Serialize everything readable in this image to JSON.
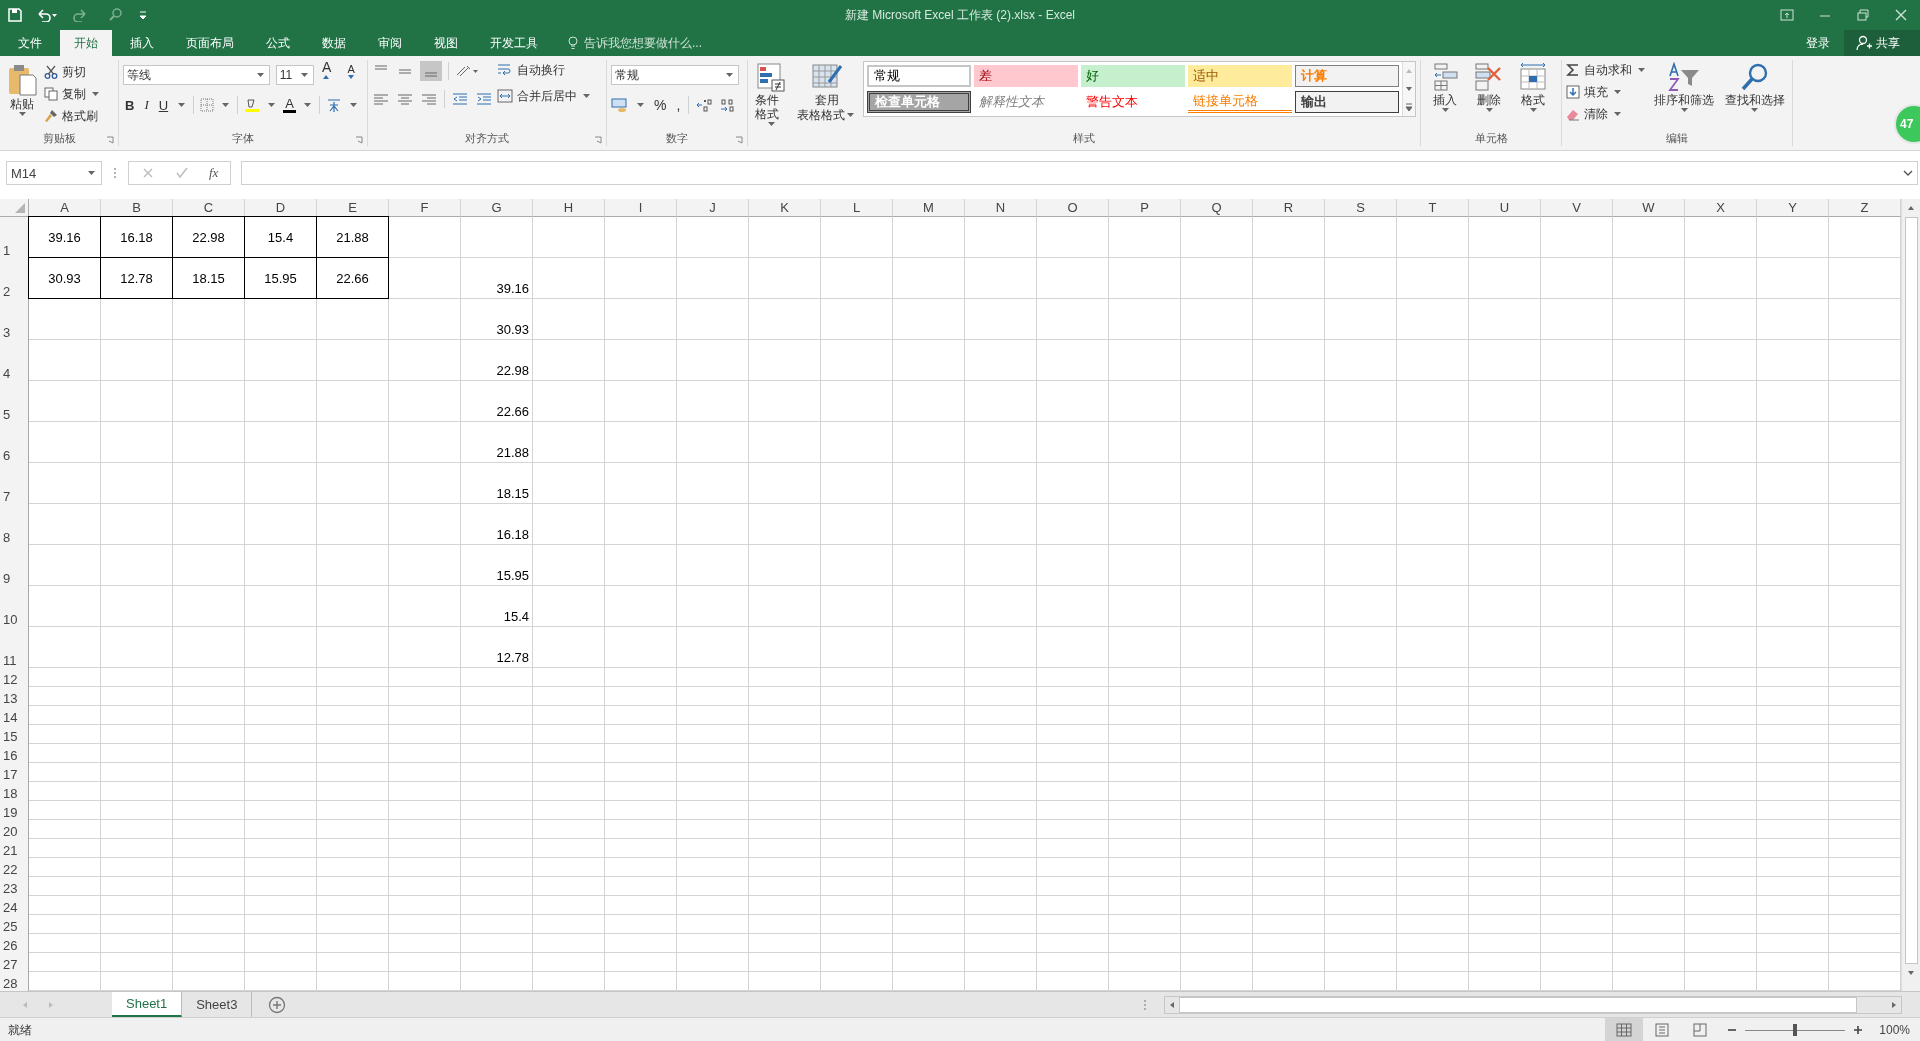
{
  "window": {
    "title": "新建 Microsoft Excel 工作表 (2).xlsx - Excel"
  },
  "tabs": [
    {
      "label": "文件",
      "selected": false
    },
    {
      "label": "开始",
      "selected": true
    },
    {
      "label": "插入",
      "selected": false
    },
    {
      "label": "页面布局",
      "selected": false
    },
    {
      "label": "公式",
      "selected": false
    },
    {
      "label": "数据",
      "selected": false
    },
    {
      "label": "审阅",
      "selected": false
    },
    {
      "label": "视图",
      "selected": false
    },
    {
      "label": "开发工具",
      "selected": false
    }
  ],
  "tell_me": {
    "placeholder": "告诉我您想要做什么..."
  },
  "account": {
    "sign_in": "登录",
    "share": "共享"
  },
  "ribbon": {
    "clipboard": {
      "paste": "粘贴",
      "cut": "剪切",
      "copy": "复制",
      "format_painter": "格式刷",
      "label": "剪贴板"
    },
    "font": {
      "font_name": "等线",
      "font_size": "11",
      "grow_font": "A",
      "shrink_font": "A",
      "bold": "B",
      "italic": "I",
      "underline": "U",
      "font_color": "A",
      "label": "字体"
    },
    "alignment": {
      "wrap_text": "自动换行",
      "merge_center": "合并后居中",
      "label": "对齐方式"
    },
    "number": {
      "format": "常规",
      "percent": "%",
      "comma": ",",
      "label": "数字"
    },
    "styles": {
      "conditional_formatting": "条件格式",
      "format_as_table": [
        "套用",
        "表格格式"
      ],
      "cell_styles": [
        {
          "label": "常规",
          "kind": "normal"
        },
        {
          "label": "差",
          "kind": "bad"
        },
        {
          "label": "好",
          "kind": "good"
        },
        {
          "label": "适中",
          "kind": "neutral"
        },
        {
          "label": "计算",
          "kind": "calculation"
        },
        {
          "label": "检查单元格",
          "kind": "check"
        },
        {
          "label": "解释性文本",
          "kind": "explanatory"
        },
        {
          "label": "警告文本",
          "kind": "warning"
        },
        {
          "label": "链接单元格",
          "kind": "linked"
        },
        {
          "label": "输出",
          "kind": "output"
        }
      ],
      "label": "样式"
    },
    "cells": {
      "insert": "插入",
      "delete": "删除",
      "format": "格式",
      "label": "单元格"
    },
    "editing": {
      "autosum": "自动求和",
      "fill": "填充",
      "clear": "清除",
      "sort_filter": "排序和筛选",
      "find_select": "查找和选择",
      "label": "编辑"
    }
  },
  "badge": {
    "text": "47"
  },
  "formula_bar": {
    "name_box": "M14",
    "function_label": "fx"
  },
  "sheet": {
    "columns": [
      "A",
      "B",
      "C",
      "D",
      "E",
      "F",
      "G",
      "H",
      "I",
      "J",
      "K",
      "L",
      "M",
      "N",
      "O",
      "P",
      "Q",
      "R",
      "S",
      "T",
      "U",
      "V",
      "W",
      "X",
      "Y",
      "Z"
    ],
    "rows": [
      {
        "label": "1",
        "cells": [
          {
            "value": "39.16",
            "bordered": true
          },
          {
            "value": "16.18",
            "bordered": true
          },
          {
            "value": "22.98",
            "bordered": true
          },
          {
            "value": "15.4",
            "bordered": true
          },
          {
            "value": "21.88",
            "bordered": true
          }
        ]
      },
      {
        "label": "2",
        "cells": [
          {
            "value": "30.93",
            "bordered": true
          },
          {
            "value": "12.78",
            "bordered": true
          },
          {
            "value": "18.15",
            "bordered": true
          },
          {
            "value": "15.95",
            "bordered": true
          },
          {
            "value": "22.66",
            "bordered": true
          },
          null,
          {
            "value": "39.16",
            "bordered": false
          }
        ]
      },
      {
        "label": "3",
        "cells": [
          null,
          null,
          null,
          null,
          null,
          null,
          {
            "value": "30.93",
            "bordered": false
          }
        ]
      },
      {
        "label": "4",
        "cells": [
          null,
          null,
          null,
          null,
          null,
          null,
          {
            "value": "22.98",
            "bordered": false
          }
        ]
      },
      {
        "label": "5",
        "cells": [
          null,
          null,
          null,
          null,
          null,
          null,
          {
            "value": "22.66",
            "bordered": false
          }
        ]
      },
      {
        "label": "6",
        "cells": [
          null,
          null,
          null,
          null,
          null,
          null,
          {
            "value": "21.88",
            "bordered": false
          }
        ]
      },
      {
        "label": "7",
        "cells": [
          null,
          null,
          null,
          null,
          null,
          null,
          {
            "value": "18.15",
            "bordered": false
          }
        ]
      },
      {
        "label": "8",
        "cells": [
          null,
          null,
          null,
          null,
          null,
          null,
          {
            "value": "16.18",
            "bordered": false
          }
        ]
      },
      {
        "label": "9",
        "cells": [
          null,
          null,
          null,
          null,
          null,
          null,
          {
            "value": "15.95",
            "bordered": false
          }
        ]
      },
      {
        "label": "10",
        "cells": [
          null,
          null,
          null,
          null,
          null,
          null,
          {
            "value": "15.4",
            "bordered": false
          }
        ]
      },
      {
        "label": "11",
        "cells": [
          null,
          null,
          null,
          null,
          null,
          null,
          {
            "value": "12.78",
            "bordered": false
          }
        ]
      },
      {
        "label": "12"
      },
      {
        "label": "13"
      },
      {
        "label": "14"
      },
      {
        "label": "15"
      },
      {
        "label": "16"
      },
      {
        "label": "17"
      },
      {
        "label": "18"
      },
      {
        "label": "19"
      },
      {
        "label": "20"
      },
      {
        "label": "21"
      },
      {
        "label": "22"
      },
      {
        "label": "23"
      },
      {
        "label": "24"
      },
      {
        "label": "25"
      },
      {
        "label": "26"
      },
      {
        "label": "27"
      },
      {
        "label": "28"
      }
    ]
  },
  "sheet_tabs": [
    {
      "label": "Sheet1",
      "selected": true
    },
    {
      "label": "Sheet3",
      "selected": false
    }
  ],
  "status_bar": {
    "status": "就绪",
    "views": [
      {
        "kind": "normal",
        "selected": true
      },
      {
        "kind": "layout",
        "selected": false
      },
      {
        "kind": "break",
        "selected": false
      }
    ],
    "zoom": {
      "level": 0.5
    },
    "zoom_percent": "100%"
  }
}
